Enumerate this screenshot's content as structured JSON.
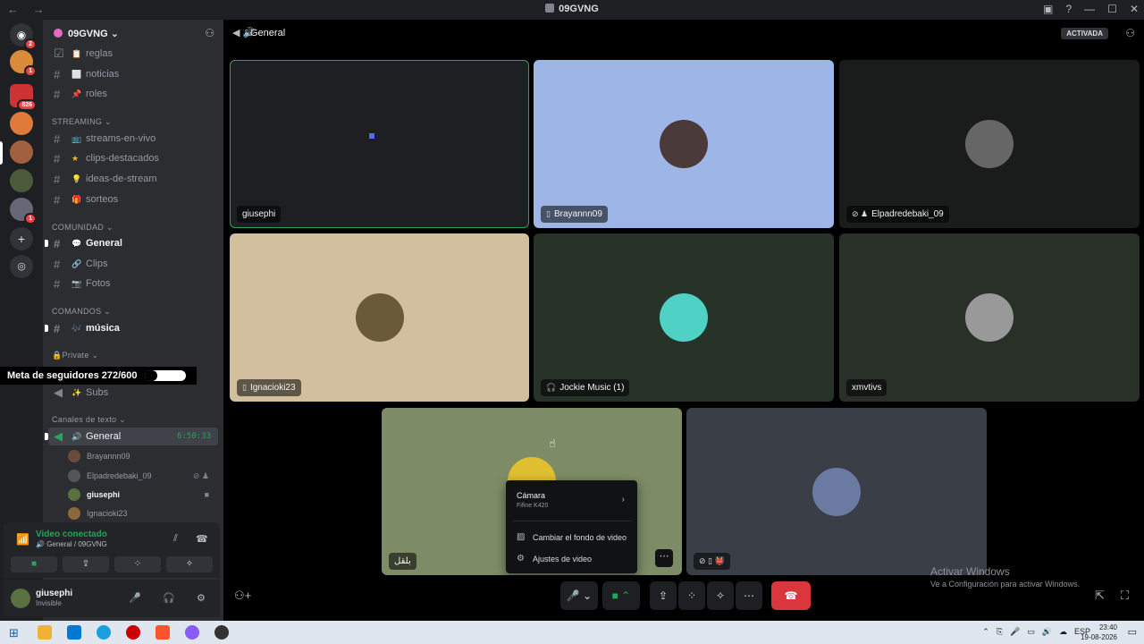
{
  "window": {
    "title": "09GVNG",
    "nav": "← →",
    "controls": [
      "▣",
      "?",
      "—",
      "☐",
      "✕"
    ]
  },
  "servers": [
    {
      "name": "home",
      "badge": "2",
      "color": "#5865f2",
      "glyph": "◉"
    },
    {
      "name": "server-1",
      "badge": "1",
      "color": "#d98a3a"
    },
    {
      "name": "server-2",
      "badge": "826",
      "color": "#c33"
    },
    {
      "name": "server-3",
      "badge": "",
      "color": "#e07a3a"
    },
    {
      "name": "server-4",
      "badge": "",
      "color": "#a06040"
    },
    {
      "name": "server-5",
      "badge": "",
      "color": "#4a5a3a"
    },
    {
      "name": "server-6",
      "badge": "1",
      "color": "#667"
    }
  ],
  "guild": {
    "name": "09GVNG",
    "chevron": "⌄",
    "add_icon": "👤"
  },
  "channels_top": [
    {
      "label": "reglas",
      "icon": "📋"
    },
    {
      "label": "noticias",
      "icon": "⬜"
    },
    {
      "label": "roles",
      "icon": "📌"
    }
  ],
  "cat_streaming": "STREAMING",
  "channels_streaming": [
    {
      "label": "streams-en-vivo",
      "icon": "📺"
    },
    {
      "label": "clips-destacados",
      "icon": "★"
    },
    {
      "label": "ideas-de-stream",
      "icon": "💡"
    },
    {
      "label": "sorteos",
      "icon": "🎁"
    }
  ],
  "cat_comunidad": "COMUNIDAD",
  "channels_comunidad": [
    {
      "label": "General",
      "icon": "💬"
    },
    {
      "label": "Clips",
      "icon": "🔗"
    },
    {
      "label": "Fotos",
      "icon": "📷"
    }
  ],
  "cat_comandos": "COMANDOS",
  "channels_comandos": [
    {
      "label": "música",
      "icon": "🎶"
    }
  ],
  "cat_private": "Private",
  "goal": "Meta de seguidores 272/600",
  "subs": "Subs",
  "cat_texto": "Canales de texto",
  "voice_channel": {
    "label": "General",
    "time": "6:50:33"
  },
  "voice_members": [
    {
      "name": "Brayannn09",
      "color": "#6a4a3a",
      "icons": ""
    },
    {
      "name": "Elpadredebaki_09",
      "color": "#555",
      "icons": "⊘ ♟"
    },
    {
      "name": "giusephi",
      "color": "#5a7040",
      "icons": "■"
    },
    {
      "name": "Ignacioki23",
      "color": "#8a6a3a",
      "icons": ""
    }
  ],
  "voice_panel": {
    "title": "Video conectado",
    "subtitle": "General / 09GVNG",
    "btn1": "■",
    "btn2": "⇪",
    "btn3": "⁘",
    "btn4": "✧"
  },
  "user": {
    "name": "giusephi",
    "status": "Invisible",
    "mic": "🎤",
    "headset": "🎧",
    "settings": "⚙"
  },
  "topbar": {
    "channel": "General",
    "badge": "ACTIVADA"
  },
  "tiles": [
    {
      "name": "giusephi",
      "icon": ""
    },
    {
      "name": "Brayannn09",
      "icon": "▯"
    },
    {
      "name": "Elpadredebaki_09",
      "icon": "⊘ ♟"
    },
    {
      "name": "Ignacioki23",
      "icon": "▯"
    },
    {
      "name": "Jockie Music (1)",
      "icon": "🎧"
    },
    {
      "name": "xmvtivs",
      "icon": ""
    },
    {
      "name": "ﺑﻠﻘﻞ",
      "icon": ""
    },
    {
      "name": "",
      "icon": "⊘ ▯ 👹"
    }
  ],
  "menu": {
    "camera": "Cámara",
    "camera_device": "Fifine K420",
    "item1": "Cambiar el fondo de video",
    "item2": "Ajustes de video"
  },
  "controls": {
    "mic": "🎤",
    "cam": "■",
    "share": "⇪",
    "activities": "⁘",
    "soundboard": "✧",
    "more": "⋯",
    "hang": "☎"
  },
  "watermark": {
    "title": "Activar Windows",
    "sub": "Ve a Configuración para activar Windows."
  },
  "taskbar": {
    "lang": "ESP",
    "time": "23:40",
    "date": "19-08-2026"
  }
}
